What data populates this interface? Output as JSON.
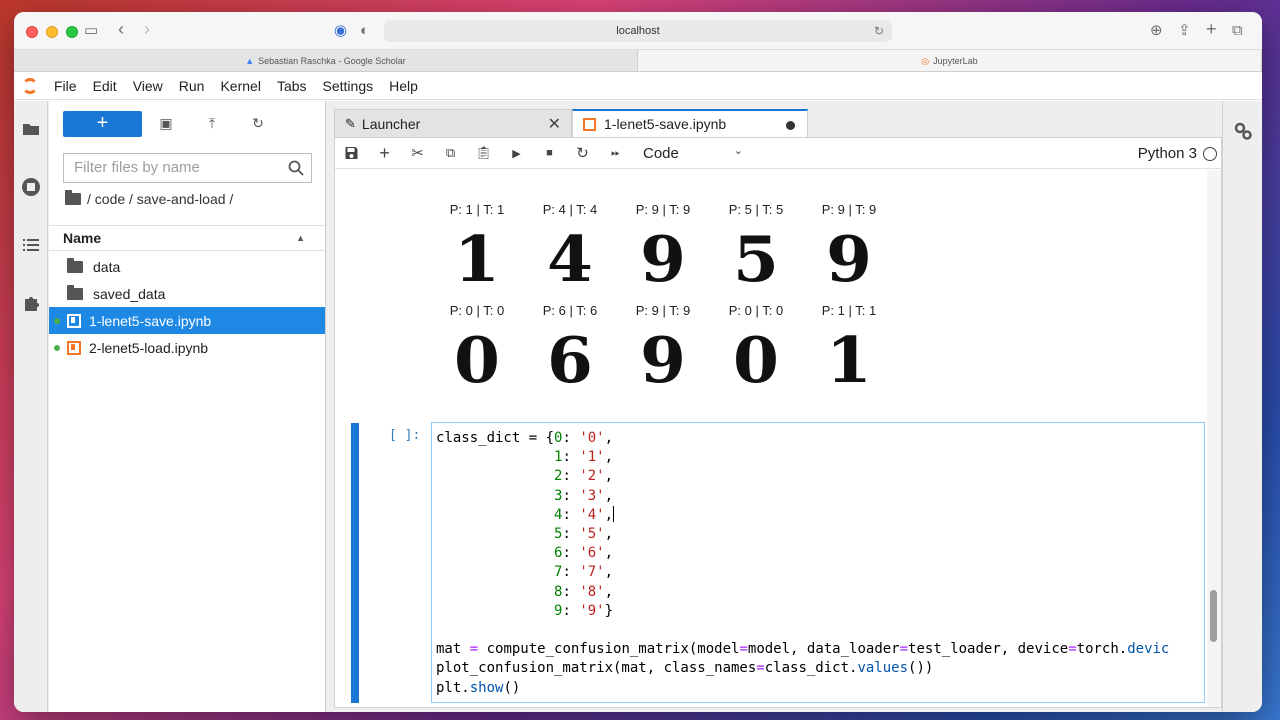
{
  "browser": {
    "url": "localhost",
    "tabs": [
      {
        "label": "Sebastian Raschka - Google Scholar"
      },
      {
        "label": "JupyterLab"
      }
    ]
  },
  "menu": [
    "File",
    "Edit",
    "View",
    "Run",
    "Kernel",
    "Tabs",
    "Settings",
    "Help"
  ],
  "filebrowser": {
    "new_label": "+",
    "filter_placeholder": "Filter files by name",
    "breadcrumb": "/ code / save-and-load /",
    "header": "Name",
    "items": [
      {
        "name": "data",
        "type": "folder"
      },
      {
        "name": "saved_data",
        "type": "folder"
      },
      {
        "name": "1-lenet5-save.ipynb",
        "type": "notebook"
      },
      {
        "name": "2-lenet5-load.ipynb",
        "type": "notebook"
      }
    ]
  },
  "doctabs": [
    {
      "label": "Launcher"
    },
    {
      "label": "1-lenet5-save.ipynb"
    }
  ],
  "nb_toolbar": {
    "cell_type": "Code",
    "kernel": "Python 3"
  },
  "output": {
    "labels_row1": [
      "P: 1 | T: 1",
      "P: 4 | T: 4",
      "P: 9 | T: 9",
      "P: 5 | T: 5",
      "P: 9 | T: 9"
    ],
    "digits_row1": [
      "1",
      "4",
      "9",
      "5",
      "9"
    ],
    "labels_row2": [
      "P: 0 | T: 0",
      "P: 6 | T: 6",
      "P: 9 | T: 9",
      "P: 0 | T: 0",
      "P: 1 | T: 1"
    ],
    "digits_row2": [
      "0",
      "6",
      "9",
      "0",
      "1"
    ]
  },
  "cell": {
    "prompt": "[ ]:",
    "lines": {
      "l1a": "class_dict = {",
      "l1k": "0",
      "l1v": "'0'",
      "k1": "1",
      "v1": "'1'",
      "k2": "2",
      "v2": "'2'",
      "k3": "3",
      "v3": "'3'",
      "k4": "4",
      "v4": "'4'",
      "k5": "5",
      "v5": "'5'",
      "k6": "6",
      "v6": "'6'",
      "k7": "7",
      "v7": "'7'",
      "k8": "8",
      "v8": "'8'",
      "k9": "9",
      "v9": "'9'",
      "mat_a": "mat ",
      "mat_b": " compute_confusion_matrix(model",
      "mat_c": "model, data_loader",
      "mat_d": "test_loader, device",
      "mat_e": "torch.",
      "mat_f": "devic",
      "plot_a": "plot_confusion_matrix(mat, class_names",
      "plot_b": "class_dict.",
      "plot_c": "values",
      "plot_d": "())",
      "show_a": "plt.",
      "show_b": "show",
      "show_c": "()"
    }
  }
}
